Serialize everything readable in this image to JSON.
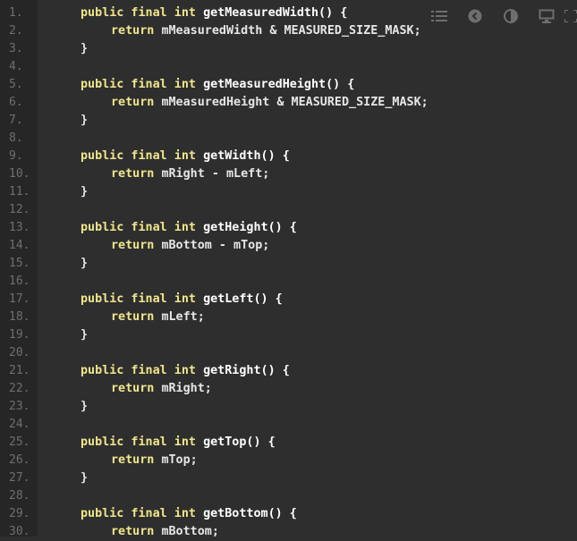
{
  "toolbar": {
    "icons": [
      "list-icon",
      "back-icon",
      "contrast-icon",
      "monitor-icon",
      "fullscreen-icon"
    ]
  },
  "colors": {
    "background": "#2e2e2e",
    "gutter": "#262626",
    "line_number": "#6f6f6f",
    "keyword": "#f0e68c",
    "text": "#f2f2f2"
  },
  "lines": [
    {
      "n": "1.",
      "kw": "public final int ",
      "rest": "getMeasuredWidth() {"
    },
    {
      "n": "2.",
      "kw": "return ",
      "rest": "mMeasuredWidth & MEASURED_SIZE_MASK;"
    },
    {
      "n": "3.",
      "kw": "",
      "rest": "}"
    },
    {
      "n": "4.",
      "kw": "",
      "rest": ""
    },
    {
      "n": "5.",
      "kw": "public final int ",
      "rest": "getMeasuredHeight() {"
    },
    {
      "n": "6.",
      "kw": "return ",
      "rest": "mMeasuredHeight & MEASURED_SIZE_MASK;"
    },
    {
      "n": "7.",
      "kw": "",
      "rest": "}"
    },
    {
      "n": "8.",
      "kw": "",
      "rest": ""
    },
    {
      "n": "9.",
      "kw": "public final int ",
      "rest": "getWidth() {"
    },
    {
      "n": "10.",
      "kw": "return ",
      "rest": "mRight - mLeft;"
    },
    {
      "n": "11.",
      "kw": "",
      "rest": "}"
    },
    {
      "n": "12.",
      "kw": "",
      "rest": ""
    },
    {
      "n": "13.",
      "kw": "public final int ",
      "rest": "getHeight() {"
    },
    {
      "n": "14.",
      "kw": "return ",
      "rest": "mBottom - mTop;"
    },
    {
      "n": "15.",
      "kw": "",
      "rest": "}"
    },
    {
      "n": "16.",
      "kw": "",
      "rest": ""
    },
    {
      "n": "17.",
      "kw": "public final int ",
      "rest": "getLeft() {"
    },
    {
      "n": "18.",
      "kw": "return ",
      "rest": "mLeft;"
    },
    {
      "n": "19.",
      "kw": "",
      "rest": "}"
    },
    {
      "n": "20.",
      "kw": "",
      "rest": ""
    },
    {
      "n": "21.",
      "kw": "public final int ",
      "rest": "getRight() {"
    },
    {
      "n": "22.",
      "kw": "return ",
      "rest": "mRight;"
    },
    {
      "n": "23.",
      "kw": "",
      "rest": "}"
    },
    {
      "n": "24.",
      "kw": "",
      "rest": ""
    },
    {
      "n": "25.",
      "kw": "public final int ",
      "rest": "getTop() {"
    },
    {
      "n": "26.",
      "kw": "return ",
      "rest": "mTop;"
    },
    {
      "n": "27.",
      "kw": "",
      "rest": "}"
    },
    {
      "n": "28.",
      "kw": "",
      "rest": ""
    },
    {
      "n": "29.",
      "kw": "public final int ",
      "rest": "getBottom() {"
    },
    {
      "n": "30.",
      "kw": "return ",
      "rest": "mBottom;"
    }
  ]
}
